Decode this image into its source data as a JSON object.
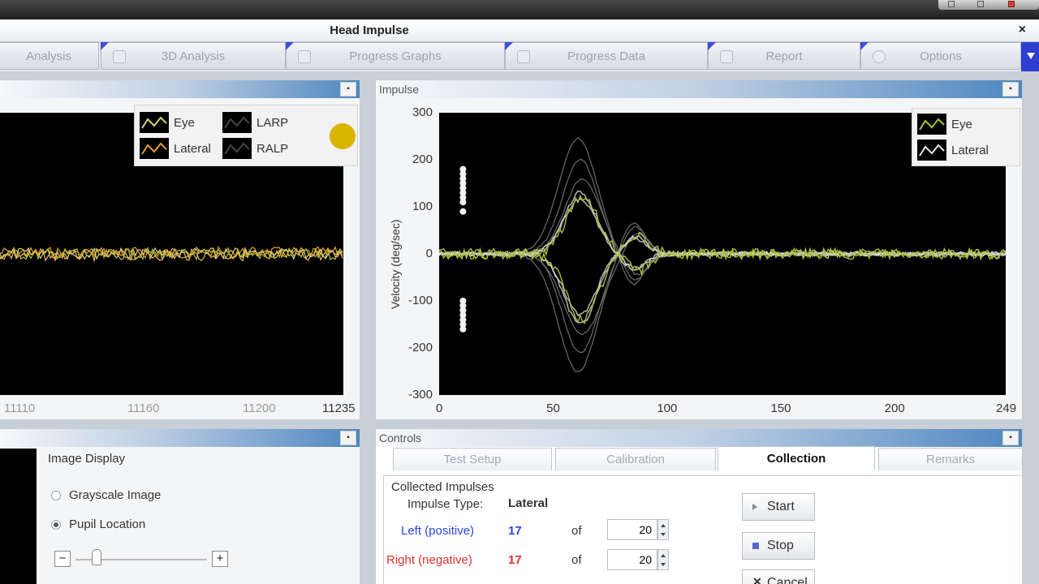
{
  "window": {
    "title": "Head Impulse",
    "close_glyph": "×"
  },
  "tabs": [
    {
      "label": "Analysis"
    },
    {
      "label": "3D Analysis"
    },
    {
      "label": "Progress Graphs"
    },
    {
      "label": "Progress Data"
    },
    {
      "label": "Report"
    },
    {
      "label": "Options"
    }
  ],
  "left_panel": {
    "legend": [
      "Eye",
      "LARP",
      "Lateral",
      "RALP"
    ],
    "x_ticks": [
      "11110",
      "11160",
      "11200",
      "11235"
    ],
    "status_dot_color": "#d8b500"
  },
  "impulse_panel": {
    "title": "Impulse",
    "legend": [
      "Eye",
      "Lateral"
    ]
  },
  "chart_data": {
    "type": "line",
    "title": "",
    "xlabel": "",
    "ylabel": "Velocity (deg/sec)",
    "xlim": [
      0,
      249
    ],
    "ylim": [
      -300,
      300
    ],
    "x_ticks": [
      "0",
      "50",
      "100",
      "150",
      "200",
      "249"
    ],
    "y_ticks": [
      "300",
      "200",
      "100",
      "0",
      "-100",
      "-200",
      "-300"
    ],
    "series": [
      {
        "name": "Eye",
        "color": "#a9c23a"
      },
      {
        "name": "Lateral",
        "color": "#d8d8d8"
      }
    ],
    "impulse_peak_positive": 120,
    "impulse_peak_negative": -140,
    "impulse_center_x": 62
  },
  "image_panel": {
    "heading": "Image Display",
    "options": [
      {
        "label": "Grayscale Image",
        "selected": false
      },
      {
        "label": "Pupil Location",
        "selected": true
      }
    ],
    "minus": "−",
    "plus": "+"
  },
  "controls": {
    "title": "Controls",
    "tabs": [
      {
        "label": "Test Setup",
        "active": false
      },
      {
        "label": "Calibration",
        "active": false
      },
      {
        "label": "Collection",
        "active": true
      },
      {
        "label": "Remarks",
        "active": false
      }
    ],
    "group_title": "Collected Impulses",
    "impulse_type_label": "Impulse Type:",
    "impulse_type_value": "Lateral",
    "left_label": "Left (positive)",
    "left_count": "17",
    "right_label": "Right (negative)",
    "right_count": "17",
    "of": "of",
    "left_total": "20",
    "right_total": "20",
    "buttons": {
      "start": "Start",
      "stop": "Stop",
      "cancel": "Cancel"
    },
    "colors": {
      "left": "#2b45e0",
      "right": "#e03030"
    }
  }
}
